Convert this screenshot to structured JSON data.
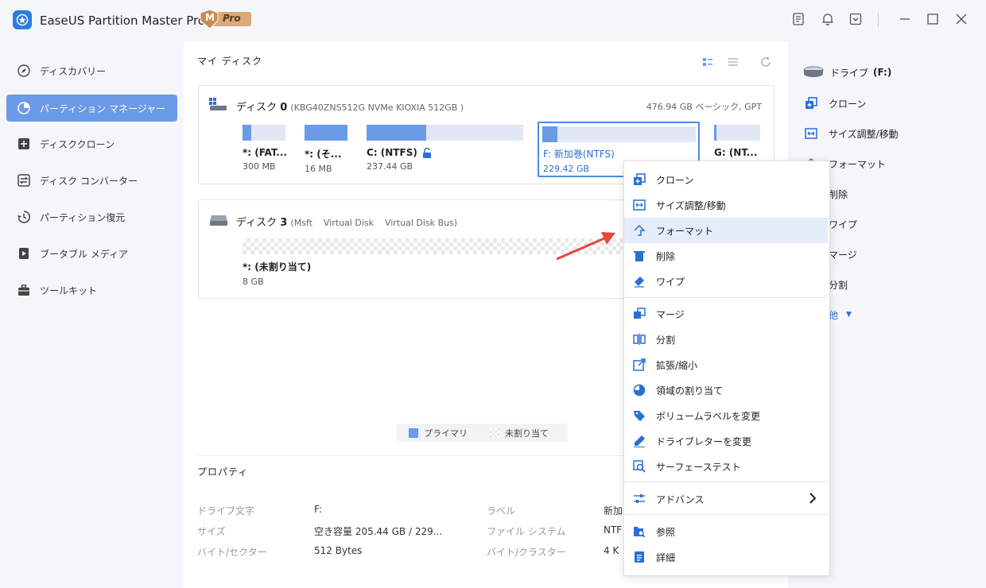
{
  "app": {
    "title": "EaseUS Partition Master Pro版",
    "badge_letter": "M",
    "badge_text": "Pro"
  },
  "colors": {
    "accent": "#6b9ae6",
    "icon_blue": "#2a6fd6",
    "selected_border": "#4f8ae6",
    "arrow_red": "#e8453c"
  },
  "sidebar": {
    "items": [
      {
        "label": "ディスカバリー",
        "icon": "compass-icon"
      },
      {
        "label": "パーティション マネージャー",
        "icon": "pie-chart-icon",
        "active": true
      },
      {
        "label": "ディスククローン",
        "icon": "disk-clone-icon"
      },
      {
        "label": "ディスク コンバーター",
        "icon": "converter-icon"
      },
      {
        "label": "パーティション復元",
        "icon": "recovery-icon"
      },
      {
        "label": "ブータブル メディア",
        "icon": "bootable-media-icon"
      },
      {
        "label": "ツールキット",
        "icon": "toolbox-icon"
      }
    ]
  },
  "main": {
    "title": "マイ ディスク",
    "disk0": {
      "name": "ディスク",
      "number": "0",
      "model": "(KBG40ZNS512G NVMe KIOXIA 512GB )",
      "summary": "476.94 GB ベーシック, GPT",
      "partitions": [
        {
          "name": "*: (FAT...",
          "size": "300 MB",
          "fill": 0.2
        },
        {
          "name": "*: (そ...",
          "size": "16 MB",
          "fill": 1.0
        },
        {
          "name": "C: (NTFS)",
          "size": "237.44 GB",
          "fill": 0.38
        },
        {
          "name": "F: 新加巻(NTFS)",
          "size": "229.42 GB",
          "fill": 0.1,
          "selected": true
        },
        {
          "name": "G: (NT...",
          "size": "",
          "fill": 0.05
        }
      ]
    },
    "disk3": {
      "name": "ディスク",
      "number": "3",
      "model": "(Msft    Virtual Disk    Virtual Disk Bus)",
      "partition": {
        "name": "*: (未割り当て)",
        "size": "8 GB"
      }
    },
    "legend": {
      "primary": "プライマリ",
      "unallocated": "未割り当て"
    },
    "properties": {
      "title": "プロパティ",
      "rows": [
        {
          "label": "ドライブ文字",
          "value": "F:",
          "label2": "ラベル",
          "value2": "新加"
        },
        {
          "label": "サイズ",
          "value": "空き容量 205.44 GB / 229...",
          "label2": "ファイル システム",
          "value2": "NTF"
        },
        {
          "label": "バイト/セクター",
          "value": "512 Bytes",
          "label2": "バイト/クラスター",
          "value2": "4 K"
        }
      ]
    }
  },
  "right_panel": {
    "drive_label": "ドライブ",
    "drive_letter": "(F:)",
    "actions": [
      "クローン",
      "サイズ調整/移動",
      "フォーマット",
      "削除",
      "ワイプ",
      "マージ",
      "分割"
    ],
    "more": "他"
  },
  "context_menu": {
    "group1": [
      {
        "label": "クローン",
        "icon": "clone-icon"
      },
      {
        "label": "サイズ調整/移動",
        "icon": "resize-icon"
      },
      {
        "label": "フォーマット",
        "icon": "format-icon",
        "highlighted": true
      },
      {
        "label": "削除",
        "icon": "trash-icon"
      },
      {
        "label": "ワイプ",
        "icon": "eraser-icon"
      }
    ],
    "group2": [
      {
        "label": "マージ",
        "icon": "merge-icon"
      },
      {
        "label": "分割",
        "icon": "split-icon"
      },
      {
        "label": "拡張/縮小",
        "icon": "expand-shrink-icon"
      },
      {
        "label": "領域の割り当て",
        "icon": "allocate-space-icon"
      },
      {
        "label": "ボリュームラベルを変更",
        "icon": "tag-icon"
      },
      {
        "label": "ドライブレターを変更",
        "icon": "pen-icon"
      },
      {
        "label": "サーフェーステスト",
        "icon": "surface-test-icon"
      }
    ],
    "advanced": {
      "label": "アドバンス",
      "icon": "sliders-icon"
    },
    "group3": [
      {
        "label": "参照",
        "icon": "browse-icon"
      },
      {
        "label": "詳細",
        "icon": "details-icon"
      }
    ]
  }
}
